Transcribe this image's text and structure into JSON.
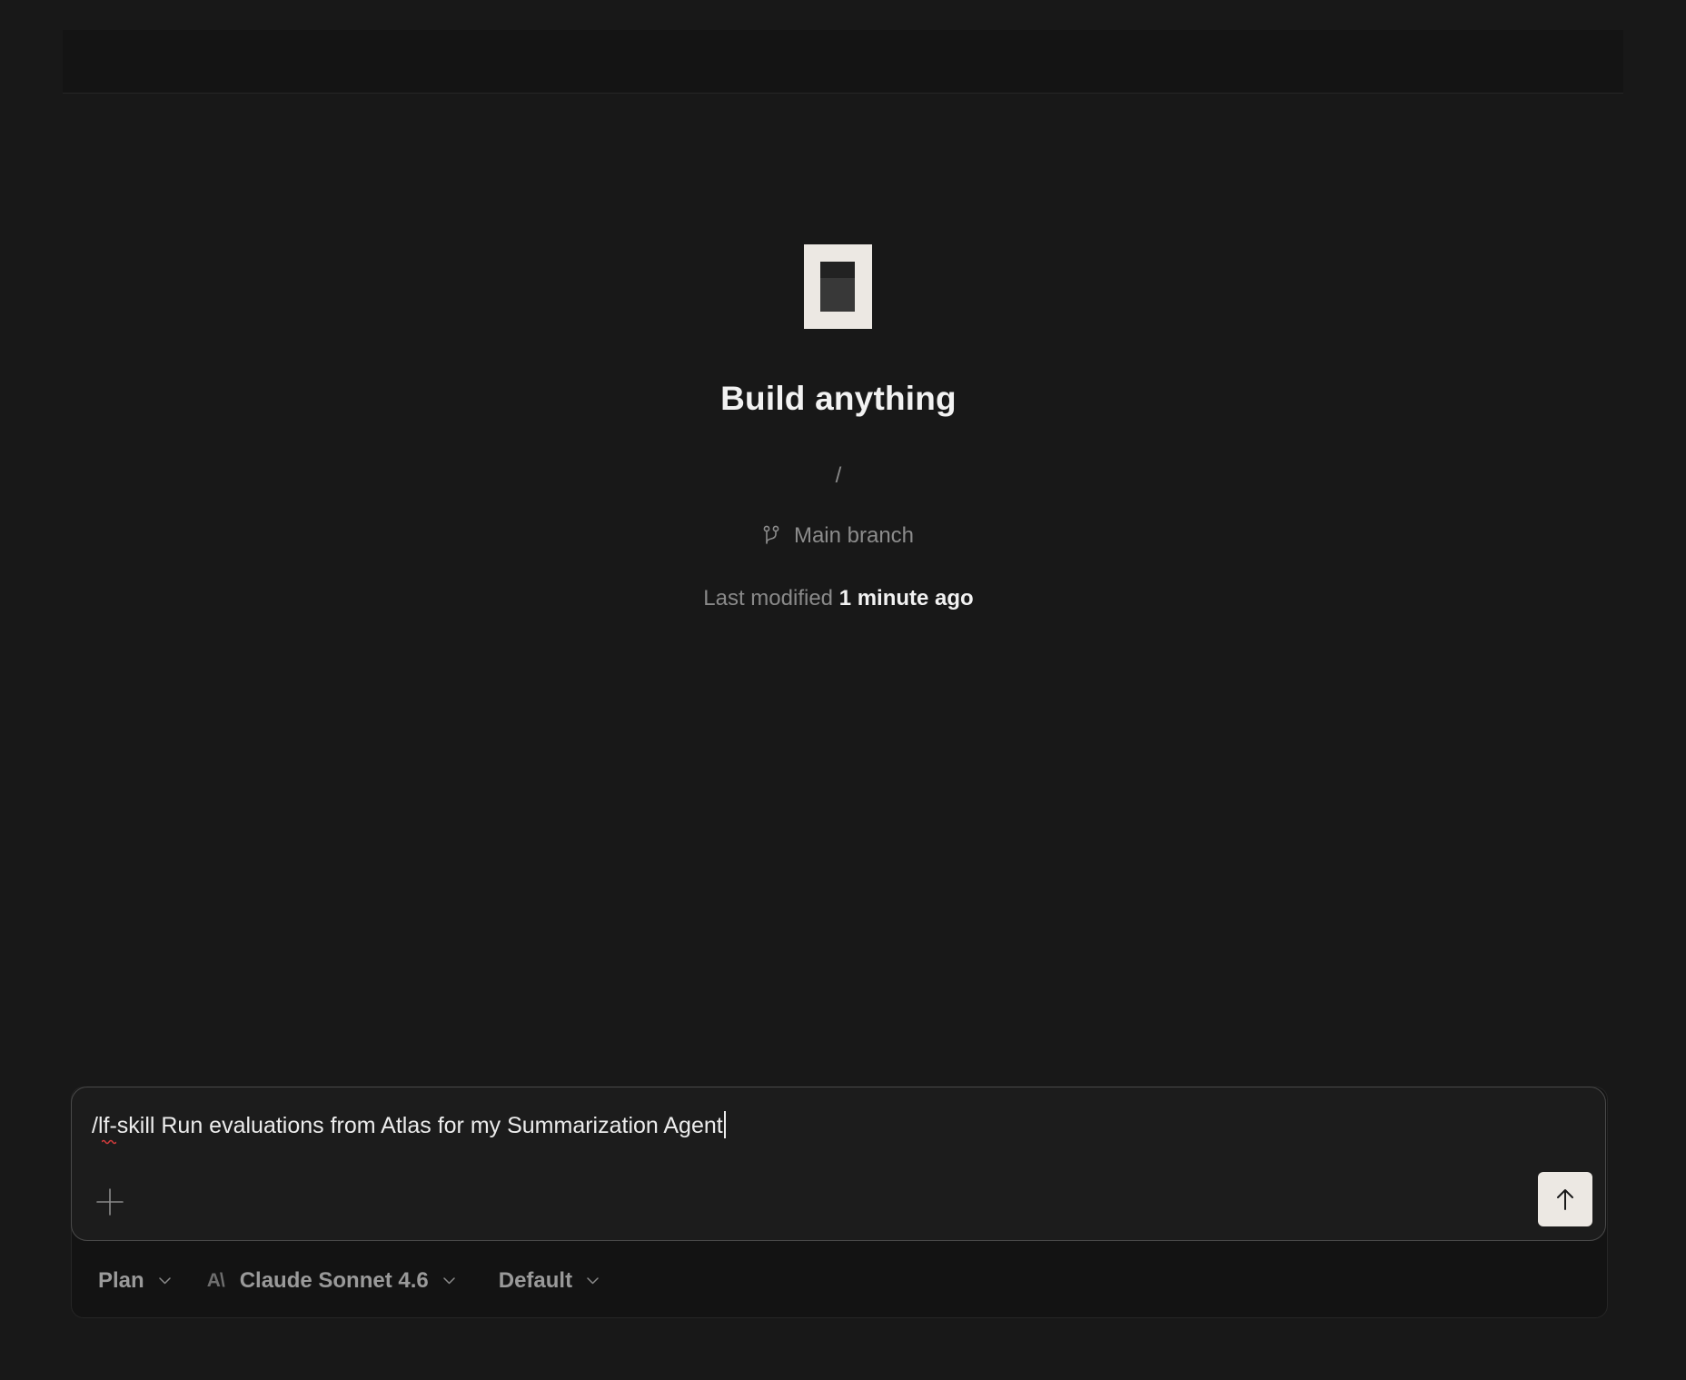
{
  "project": {
    "title": "Build anything",
    "path": "/",
    "branch": "Main branch",
    "last_modified_label": "Last modified",
    "last_modified_value": "1 minute ago"
  },
  "composer": {
    "input_value": "/lf-skill Run evaluations from Atlas for my Summarization Agent",
    "add_icon": "plus-icon",
    "send_icon": "arrow-up-icon"
  },
  "toolbar": {
    "mode": "Plan",
    "model_icon": "anthropic-logo-icon",
    "model_icon_text": "A\\",
    "model": "Claude Sonnet 4.6",
    "profile": "Default"
  },
  "colors": {
    "background": "#181818",
    "composer_border": "#4a4a4a",
    "send_button": "#ece8e3",
    "logo": "#ece8e3"
  }
}
